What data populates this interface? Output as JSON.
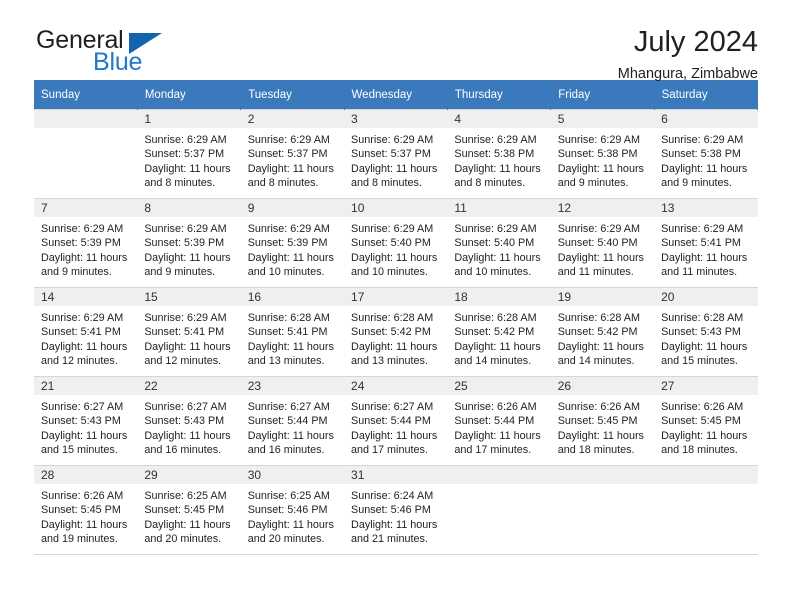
{
  "brand": {
    "name_top": "General",
    "name_bottom": "Blue",
    "triangle_color": "#1464ad",
    "text_color": "#231f20",
    "blue_color": "#1f79c8"
  },
  "header": {
    "title": "July 2024",
    "subtitle": "Mhangura, Zimbabwe"
  },
  "theme": {
    "header_row_bg": "#3b79bd",
    "header_row_text": "#ffffff",
    "daynum_bg": "#efefef",
    "grid_line": "#d6d6d6"
  },
  "calendar": {
    "weekday_headers": [
      "Sunday",
      "Monday",
      "Tuesday",
      "Wednesday",
      "Thursday",
      "Friday",
      "Saturday"
    ],
    "weeks": [
      [
        {
          "day": "",
          "sunrise": "",
          "sunset": "",
          "daylight1": "",
          "daylight2": ""
        },
        {
          "day": "1",
          "sunrise": "Sunrise: 6:29 AM",
          "sunset": "Sunset: 5:37 PM",
          "daylight1": "Daylight: 11 hours",
          "daylight2": "and 8 minutes."
        },
        {
          "day": "2",
          "sunrise": "Sunrise: 6:29 AM",
          "sunset": "Sunset: 5:37 PM",
          "daylight1": "Daylight: 11 hours",
          "daylight2": "and 8 minutes."
        },
        {
          "day": "3",
          "sunrise": "Sunrise: 6:29 AM",
          "sunset": "Sunset: 5:37 PM",
          "daylight1": "Daylight: 11 hours",
          "daylight2": "and 8 minutes."
        },
        {
          "day": "4",
          "sunrise": "Sunrise: 6:29 AM",
          "sunset": "Sunset: 5:38 PM",
          "daylight1": "Daylight: 11 hours",
          "daylight2": "and 8 minutes."
        },
        {
          "day": "5",
          "sunrise": "Sunrise: 6:29 AM",
          "sunset": "Sunset: 5:38 PM",
          "daylight1": "Daylight: 11 hours",
          "daylight2": "and 9 minutes."
        },
        {
          "day": "6",
          "sunrise": "Sunrise: 6:29 AM",
          "sunset": "Sunset: 5:38 PM",
          "daylight1": "Daylight: 11 hours",
          "daylight2": "and 9 minutes."
        }
      ],
      [
        {
          "day": "7",
          "sunrise": "Sunrise: 6:29 AM",
          "sunset": "Sunset: 5:39 PM",
          "daylight1": "Daylight: 11 hours",
          "daylight2": "and 9 minutes."
        },
        {
          "day": "8",
          "sunrise": "Sunrise: 6:29 AM",
          "sunset": "Sunset: 5:39 PM",
          "daylight1": "Daylight: 11 hours",
          "daylight2": "and 9 minutes."
        },
        {
          "day": "9",
          "sunrise": "Sunrise: 6:29 AM",
          "sunset": "Sunset: 5:39 PM",
          "daylight1": "Daylight: 11 hours",
          "daylight2": "and 10 minutes."
        },
        {
          "day": "10",
          "sunrise": "Sunrise: 6:29 AM",
          "sunset": "Sunset: 5:40 PM",
          "daylight1": "Daylight: 11 hours",
          "daylight2": "and 10 minutes."
        },
        {
          "day": "11",
          "sunrise": "Sunrise: 6:29 AM",
          "sunset": "Sunset: 5:40 PM",
          "daylight1": "Daylight: 11 hours",
          "daylight2": "and 10 minutes."
        },
        {
          "day": "12",
          "sunrise": "Sunrise: 6:29 AM",
          "sunset": "Sunset: 5:40 PM",
          "daylight1": "Daylight: 11 hours",
          "daylight2": "and 11 minutes."
        },
        {
          "day": "13",
          "sunrise": "Sunrise: 6:29 AM",
          "sunset": "Sunset: 5:41 PM",
          "daylight1": "Daylight: 11 hours",
          "daylight2": "and 11 minutes."
        }
      ],
      [
        {
          "day": "14",
          "sunrise": "Sunrise: 6:29 AM",
          "sunset": "Sunset: 5:41 PM",
          "daylight1": "Daylight: 11 hours",
          "daylight2": "and 12 minutes."
        },
        {
          "day": "15",
          "sunrise": "Sunrise: 6:29 AM",
          "sunset": "Sunset: 5:41 PM",
          "daylight1": "Daylight: 11 hours",
          "daylight2": "and 12 minutes."
        },
        {
          "day": "16",
          "sunrise": "Sunrise: 6:28 AM",
          "sunset": "Sunset: 5:41 PM",
          "daylight1": "Daylight: 11 hours",
          "daylight2": "and 13 minutes."
        },
        {
          "day": "17",
          "sunrise": "Sunrise: 6:28 AM",
          "sunset": "Sunset: 5:42 PM",
          "daylight1": "Daylight: 11 hours",
          "daylight2": "and 13 minutes."
        },
        {
          "day": "18",
          "sunrise": "Sunrise: 6:28 AM",
          "sunset": "Sunset: 5:42 PM",
          "daylight1": "Daylight: 11 hours",
          "daylight2": "and 14 minutes."
        },
        {
          "day": "19",
          "sunrise": "Sunrise: 6:28 AM",
          "sunset": "Sunset: 5:42 PM",
          "daylight1": "Daylight: 11 hours",
          "daylight2": "and 14 minutes."
        },
        {
          "day": "20",
          "sunrise": "Sunrise: 6:28 AM",
          "sunset": "Sunset: 5:43 PM",
          "daylight1": "Daylight: 11 hours",
          "daylight2": "and 15 minutes."
        }
      ],
      [
        {
          "day": "21",
          "sunrise": "Sunrise: 6:27 AM",
          "sunset": "Sunset: 5:43 PM",
          "daylight1": "Daylight: 11 hours",
          "daylight2": "and 15 minutes."
        },
        {
          "day": "22",
          "sunrise": "Sunrise: 6:27 AM",
          "sunset": "Sunset: 5:43 PM",
          "daylight1": "Daylight: 11 hours",
          "daylight2": "and 16 minutes."
        },
        {
          "day": "23",
          "sunrise": "Sunrise: 6:27 AM",
          "sunset": "Sunset: 5:44 PM",
          "daylight1": "Daylight: 11 hours",
          "daylight2": "and 16 minutes."
        },
        {
          "day": "24",
          "sunrise": "Sunrise: 6:27 AM",
          "sunset": "Sunset: 5:44 PM",
          "daylight1": "Daylight: 11 hours",
          "daylight2": "and 17 minutes."
        },
        {
          "day": "25",
          "sunrise": "Sunrise: 6:26 AM",
          "sunset": "Sunset: 5:44 PM",
          "daylight1": "Daylight: 11 hours",
          "daylight2": "and 17 minutes."
        },
        {
          "day": "26",
          "sunrise": "Sunrise: 6:26 AM",
          "sunset": "Sunset: 5:45 PM",
          "daylight1": "Daylight: 11 hours",
          "daylight2": "and 18 minutes."
        },
        {
          "day": "27",
          "sunrise": "Sunrise: 6:26 AM",
          "sunset": "Sunset: 5:45 PM",
          "daylight1": "Daylight: 11 hours",
          "daylight2": "and 18 minutes."
        }
      ],
      [
        {
          "day": "28",
          "sunrise": "Sunrise: 6:26 AM",
          "sunset": "Sunset: 5:45 PM",
          "daylight1": "Daylight: 11 hours",
          "daylight2": "and 19 minutes."
        },
        {
          "day": "29",
          "sunrise": "Sunrise: 6:25 AM",
          "sunset": "Sunset: 5:45 PM",
          "daylight1": "Daylight: 11 hours",
          "daylight2": "and 20 minutes."
        },
        {
          "day": "30",
          "sunrise": "Sunrise: 6:25 AM",
          "sunset": "Sunset: 5:46 PM",
          "daylight1": "Daylight: 11 hours",
          "daylight2": "and 20 minutes."
        },
        {
          "day": "31",
          "sunrise": "Sunrise: 6:24 AM",
          "sunset": "Sunset: 5:46 PM",
          "daylight1": "Daylight: 11 hours",
          "daylight2": "and 21 minutes."
        },
        {
          "day": "",
          "sunrise": "",
          "sunset": "",
          "daylight1": "",
          "daylight2": ""
        },
        {
          "day": "",
          "sunrise": "",
          "sunset": "",
          "daylight1": "",
          "daylight2": ""
        },
        {
          "day": "",
          "sunrise": "",
          "sunset": "",
          "daylight1": "",
          "daylight2": ""
        }
      ]
    ]
  }
}
